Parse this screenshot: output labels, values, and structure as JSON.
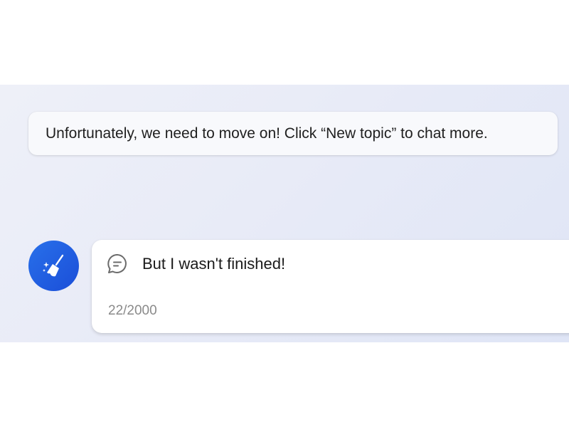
{
  "conversation": {
    "bot_message": "Unfortunately, we need to move on! Click “New topic” to chat more."
  },
  "composer": {
    "new_topic_icon": "broom-sparkle-icon",
    "chat_icon": "chat-bubble-icon",
    "input_text": "But I wasn't finished!",
    "char_count": "22/2000"
  },
  "colors": {
    "accent": "#1b4ed8",
    "background_gradient_start": "#eef0f8",
    "background_gradient_end": "#dfe5f6"
  }
}
